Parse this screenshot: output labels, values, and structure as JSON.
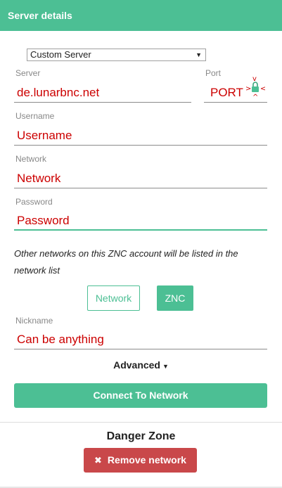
{
  "header": {
    "title": "Server details"
  },
  "server_select": {
    "value": "Custom Server"
  },
  "fields": {
    "server": {
      "label": "Server",
      "value": "de.lunarbnc.net"
    },
    "port": {
      "label": "Port",
      "value": "PORT"
    },
    "username": {
      "label": "Username",
      "value": "Username"
    },
    "network": {
      "label": "Network",
      "value": "Network"
    },
    "password": {
      "label": "Password",
      "value": "Password"
    },
    "nickname": {
      "label": "Nickname",
      "value": "Can be anything"
    }
  },
  "note": "Other networks on this ZNC account will be listed in the network list",
  "mode_buttons": {
    "network": "Network",
    "znc": "ZNC"
  },
  "advanced": {
    "label": "Advanced"
  },
  "connect": {
    "label": "Connect To Network"
  },
  "danger_zone": {
    "title": "Danger Zone",
    "remove_label": "Remove network"
  },
  "icons": {
    "tls_lock": "lock-icon",
    "select_caret": "caret-down-icon",
    "remove": "close-icon"
  },
  "colors": {
    "accent": "#4cbf94",
    "danger": "#c9484a",
    "annotation": "#cc0000"
  }
}
